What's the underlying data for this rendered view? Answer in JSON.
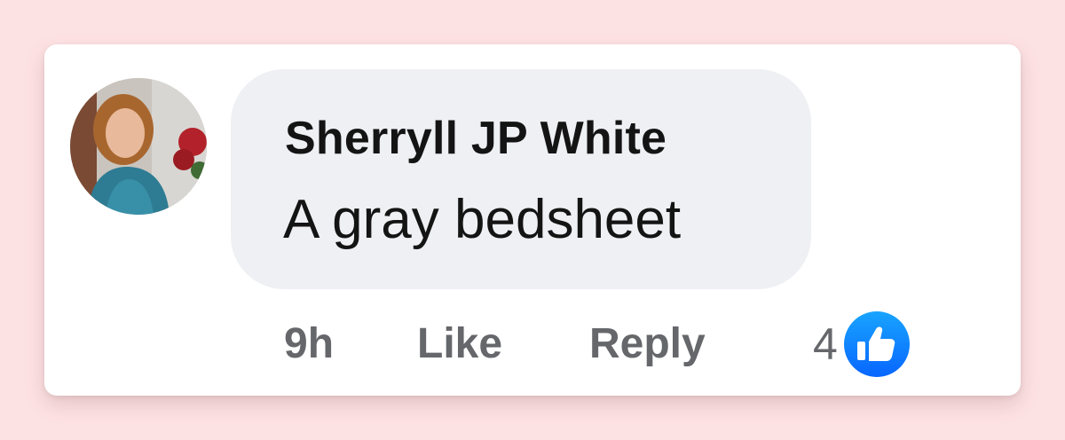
{
  "comment": {
    "author": "Sherryll JP White",
    "text": "A gray bedsheet",
    "time": "9h",
    "like_label": "Like",
    "reply_label": "Reply",
    "reaction_count": "4",
    "reaction_icon": "thumbs-up-icon"
  },
  "colors": {
    "page_background": "#fde2e4",
    "card_background": "#ffffff",
    "bubble_background": "#eff0f4",
    "text_primary": "#141414",
    "text_secondary": "#65676b",
    "like_blue": "#1877f2"
  }
}
